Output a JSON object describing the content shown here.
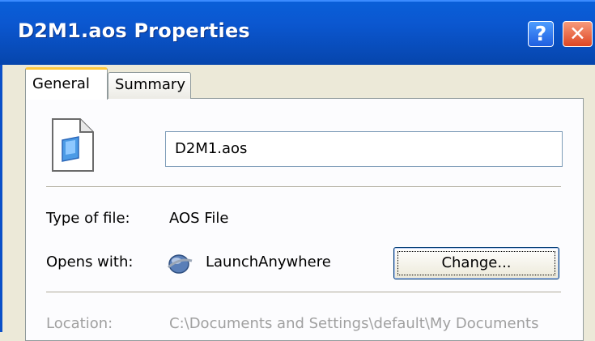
{
  "window": {
    "title": "D2M1.aos Properties",
    "help_glyph": "?",
    "close_glyph": "✕"
  },
  "tabs": [
    {
      "label": "General",
      "active": true
    },
    {
      "label": "Summary",
      "active": false
    }
  ],
  "general": {
    "file_name": "D2M1.aos",
    "type_label": "Type of file:",
    "type_value": "AOS File",
    "opens_label": "Opens with:",
    "opens_value": "LaunchAnywhere",
    "change_button": "Change...",
    "location_label": "Location:",
    "location_value": "C:\\Documents and Settings\\default\\My Documents"
  },
  "icons": {
    "file": "document-icon",
    "app": "launchanywhere-icon"
  },
  "colors": {
    "titlebar": "#0b57d0",
    "close_button": "#de4623",
    "active_tab_accent": "#ffc83c"
  }
}
